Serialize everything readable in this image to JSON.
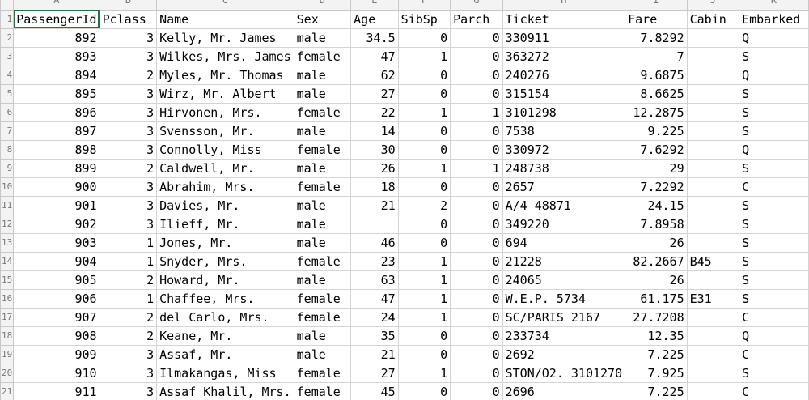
{
  "column_letters": [
    "A",
    "B",
    "C",
    "D",
    "E",
    "F",
    "G",
    "H",
    "I",
    "J",
    "K"
  ],
  "row_numbers": [
    "1",
    "2",
    "3",
    "4",
    "5",
    "6",
    "7",
    "8",
    "9",
    "10",
    "11",
    "12",
    "13",
    "14",
    "15",
    "16",
    "17",
    "18",
    "19",
    "20",
    "21"
  ],
  "headers": [
    "PassengerId",
    "Pclass",
    "Name",
    "Sex",
    "Age",
    "SibSp",
    "Parch",
    "Ticket",
    "Fare",
    "Cabin",
    "Embarked"
  ],
  "rows": [
    [
      "892",
      "3",
      "Kelly, Mr. James",
      "male",
      "34.5",
      "0",
      "0",
      "330911",
      "7.8292",
      "",
      "Q"
    ],
    [
      "893",
      "3",
      "Wilkes, Mrs. James",
      "female",
      "47",
      "1",
      "0",
      "363272",
      "7",
      "",
      "S"
    ],
    [
      "894",
      "2",
      "Myles, Mr. Thomas",
      "male",
      "62",
      "0",
      "0",
      "240276",
      "9.6875",
      "",
      "Q"
    ],
    [
      "895",
      "3",
      "Wirz, Mr. Albert",
      "male",
      "27",
      "0",
      "0",
      "315154",
      "8.6625",
      "",
      "S"
    ],
    [
      "896",
      "3",
      "Hirvonen, Mrs.",
      "female",
      "22",
      "1",
      "1",
      "3101298",
      "12.2875",
      "",
      "S"
    ],
    [
      "897",
      "3",
      "Svensson, Mr.",
      "male",
      "14",
      "0",
      "0",
      "7538",
      "9.225",
      "",
      "S"
    ],
    [
      "898",
      "3",
      "Connolly, Miss",
      "female",
      "30",
      "0",
      "0",
      "330972",
      "7.6292",
      "",
      "Q"
    ],
    [
      "899",
      "2",
      "Caldwell, Mr.",
      "male",
      "26",
      "1",
      "1",
      "248738",
      "29",
      "",
      "S"
    ],
    [
      "900",
      "3",
      "Abrahim, Mrs.",
      "female",
      "18",
      "0",
      "0",
      "2657",
      "7.2292",
      "",
      "C"
    ],
    [
      "901",
      "3",
      "Davies, Mr.",
      "male",
      "21",
      "2",
      "0",
      "A/4 48871",
      "24.15",
      "",
      "S"
    ],
    [
      "902",
      "3",
      "Ilieff, Mr.",
      "male",
      "",
      "0",
      "0",
      "349220",
      "7.8958",
      "",
      "S"
    ],
    [
      "903",
      "1",
      "Jones, Mr.",
      "male",
      "46",
      "0",
      "0",
      "694",
      "26",
      "",
      "S"
    ],
    [
      "904",
      "1",
      "Snyder, Mrs.",
      "female",
      "23",
      "1",
      "0",
      "21228",
      "82.2667",
      "B45",
      "S"
    ],
    [
      "905",
      "2",
      "Howard, Mr.",
      "male",
      "63",
      "1",
      "0",
      "24065",
      "26",
      "",
      "S"
    ],
    [
      "906",
      "1",
      "Chaffee, Mrs.",
      "female",
      "47",
      "1",
      "0",
      "W.E.P. 5734",
      "61.175",
      "E31",
      "S"
    ],
    [
      "907",
      "2",
      "del Carlo, Mrs.",
      "female",
      "24",
      "1",
      "0",
      "SC/PARIS 2167",
      "27.7208",
      "",
      "C"
    ],
    [
      "908",
      "2",
      "Keane, Mr.",
      "male",
      "35",
      "0",
      "0",
      "233734",
      "12.35",
      "",
      "Q"
    ],
    [
      "909",
      "3",
      "Assaf, Mr.",
      "male",
      "21",
      "0",
      "0",
      "2692",
      "7.225",
      "",
      "C"
    ],
    [
      "910",
      "3",
      "Ilmakangas, Miss",
      "female",
      "27",
      "1",
      "0",
      "STON/O2. 3101270",
      "7.925",
      "",
      "S"
    ],
    [
      "911",
      "3",
      "Assaf Khalil, Mrs.",
      "female",
      "45",
      "0",
      "0",
      "2696",
      "7.225",
      "",
      "C"
    ]
  ],
  "numeric_columns": [
    0,
    1,
    4,
    5,
    6,
    8
  ],
  "selected_cell": "A1"
}
